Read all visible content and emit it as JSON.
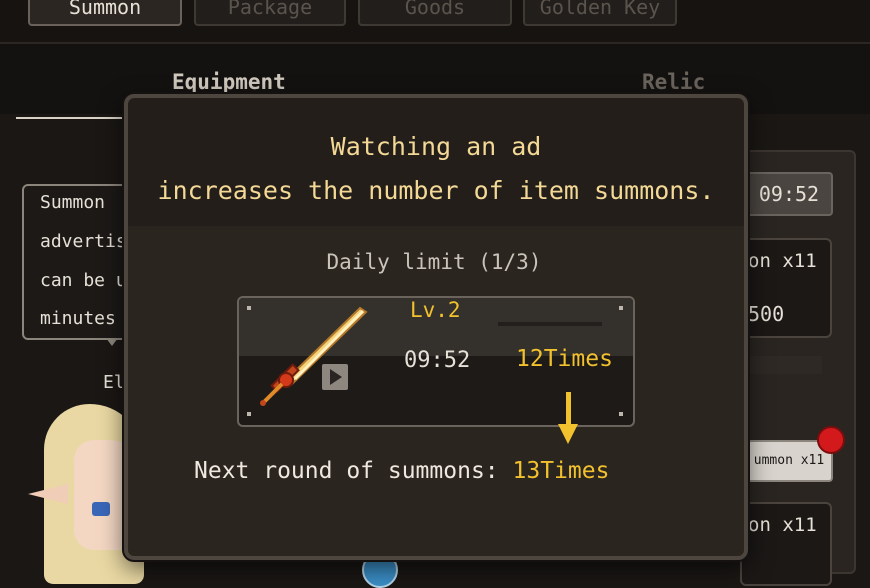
{
  "tabs": [
    {
      "label": "Summon",
      "active": true
    },
    {
      "label": "Package",
      "active": false
    },
    {
      "label": "Goods",
      "active": false
    },
    {
      "label": "Golden Key",
      "active": false
    }
  ],
  "subtabs": {
    "equipment": "Equipment",
    "relic": "Relic"
  },
  "npc": {
    "speech_lines": [
      "Summon",
      "advertis",
      "can be u",
      "minutes"
    ],
    "name": "El"
  },
  "right_panel": {
    "timer": "09:52",
    "card1_label": "on x11",
    "card1_price": "500",
    "summon_button": "ummon x11",
    "card2_label": "on x11"
  },
  "modal": {
    "title_line1": "Watching an ad",
    "title_line2": "increases the number of item summons.",
    "daily_limit": "Daily limit (1/3)",
    "item": {
      "level": "Lv.2",
      "timer": "09:52",
      "times": "12Times"
    },
    "next_round_label": "Next round of summons: ",
    "next_round_value": "13Times"
  },
  "colors": {
    "accent_gold": "#f2c12e",
    "title_gold": "#f3d896",
    "notification_red": "#d3191b"
  }
}
